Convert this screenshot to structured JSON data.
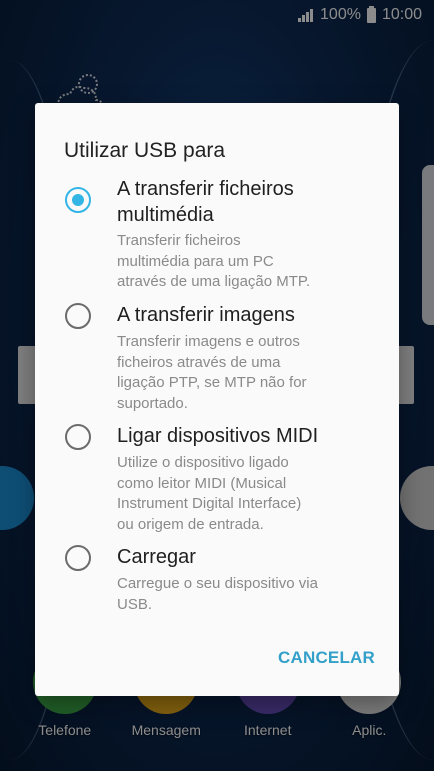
{
  "status_bar": {
    "battery": "100%",
    "time": "10:00",
    "signal_icon": "signal-icon",
    "battery_icon": "battery-icon"
  },
  "dialog": {
    "title": "Utilizar USB para",
    "options": [
      {
        "title_line1": "A transferir ficheiros",
        "title_line2": "multimédia",
        "desc_line1": "Transferir ficheiros",
        "desc_line2": "multimédia para um PC",
        "desc_line3": "através de uma ligação MTP.",
        "selected": true
      },
      {
        "title_line1": "A transferir imagens",
        "desc_line1": "Transferir imagens e outros",
        "desc_line2": "ficheiros através de uma",
        "desc_line3": "ligação PTP, se MTP não for",
        "desc_line4": "suportado.",
        "selected": false
      },
      {
        "title_line1": "Ligar dispositivos MIDI",
        "desc_line1": "Utilize o dispositivo ligado",
        "desc_line2": "como leitor MIDI (Musical",
        "desc_line3": "Instrument Digital Interface)",
        "desc_line4": "ou origem de entrada.",
        "selected": false
      },
      {
        "title_line1": "Carregar",
        "desc_line1": "Carregue o seu dispositivo via",
        "desc_line2": "USB.",
        "selected": false
      }
    ],
    "cancel_label": "CANCELAR",
    "accent_color": "#33b5e5"
  },
  "dock": {
    "items": [
      {
        "label": "Telefone",
        "color": "#3fae49"
      },
      {
        "label": "Mensagem",
        "color": "#f1b21b"
      },
      {
        "label": "Internet",
        "color": "#6a4fc2"
      },
      {
        "label": "Aplic.",
        "color": "#e6e6e6"
      }
    ]
  }
}
